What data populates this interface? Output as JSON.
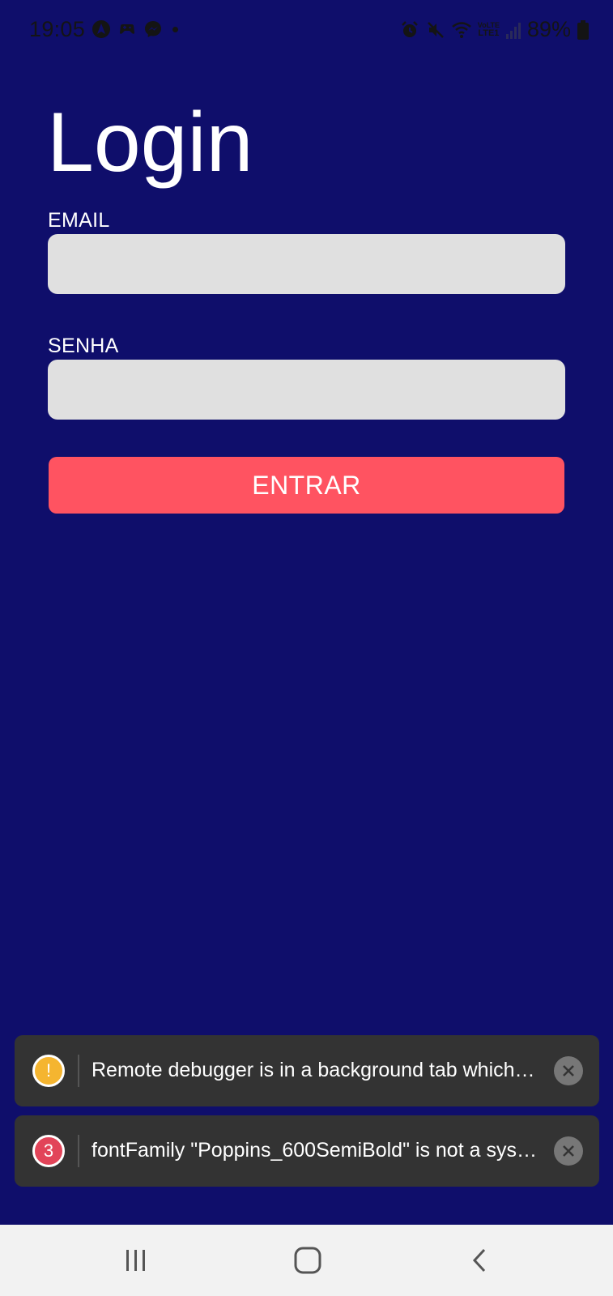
{
  "status_bar": {
    "time": "19:05",
    "left_icons": [
      "location-icon",
      "game-controller-icon",
      "messenger-icon",
      "notification-dot-icon"
    ],
    "right_icons": [
      "alarm-icon",
      "mute-icon",
      "wifi-icon",
      "volte-lte-icon",
      "signal-icon",
      "battery-icon"
    ],
    "volte_label": "VoLTE",
    "battery_text": "89%"
  },
  "login": {
    "title": "Login",
    "email_label": "EMAIL",
    "email_value": "",
    "password_label": "SENHA",
    "password_value": "",
    "submit_label": "ENTRAR"
  },
  "toasts": [
    {
      "badge": "!",
      "badge_color": "#f5b530",
      "text": "Remote debugger is in a background tab which…",
      "close_icon": "close-icon"
    },
    {
      "badge": "3",
      "badge_color": "#e24459",
      "text": "fontFamily \"Poppins_600SemiBold\" is not a sys…",
      "close_icon": "close-icon"
    }
  ],
  "nav_bar": {
    "buttons": [
      "recent-apps-icon",
      "home-icon",
      "back-icon"
    ]
  },
  "colors": {
    "background": "#0f0e6b",
    "input_bg": "#e0e0e0",
    "button_bg": "#ff5361",
    "toast_bg": "#333333",
    "nav_bg": "#f2f2f2"
  }
}
